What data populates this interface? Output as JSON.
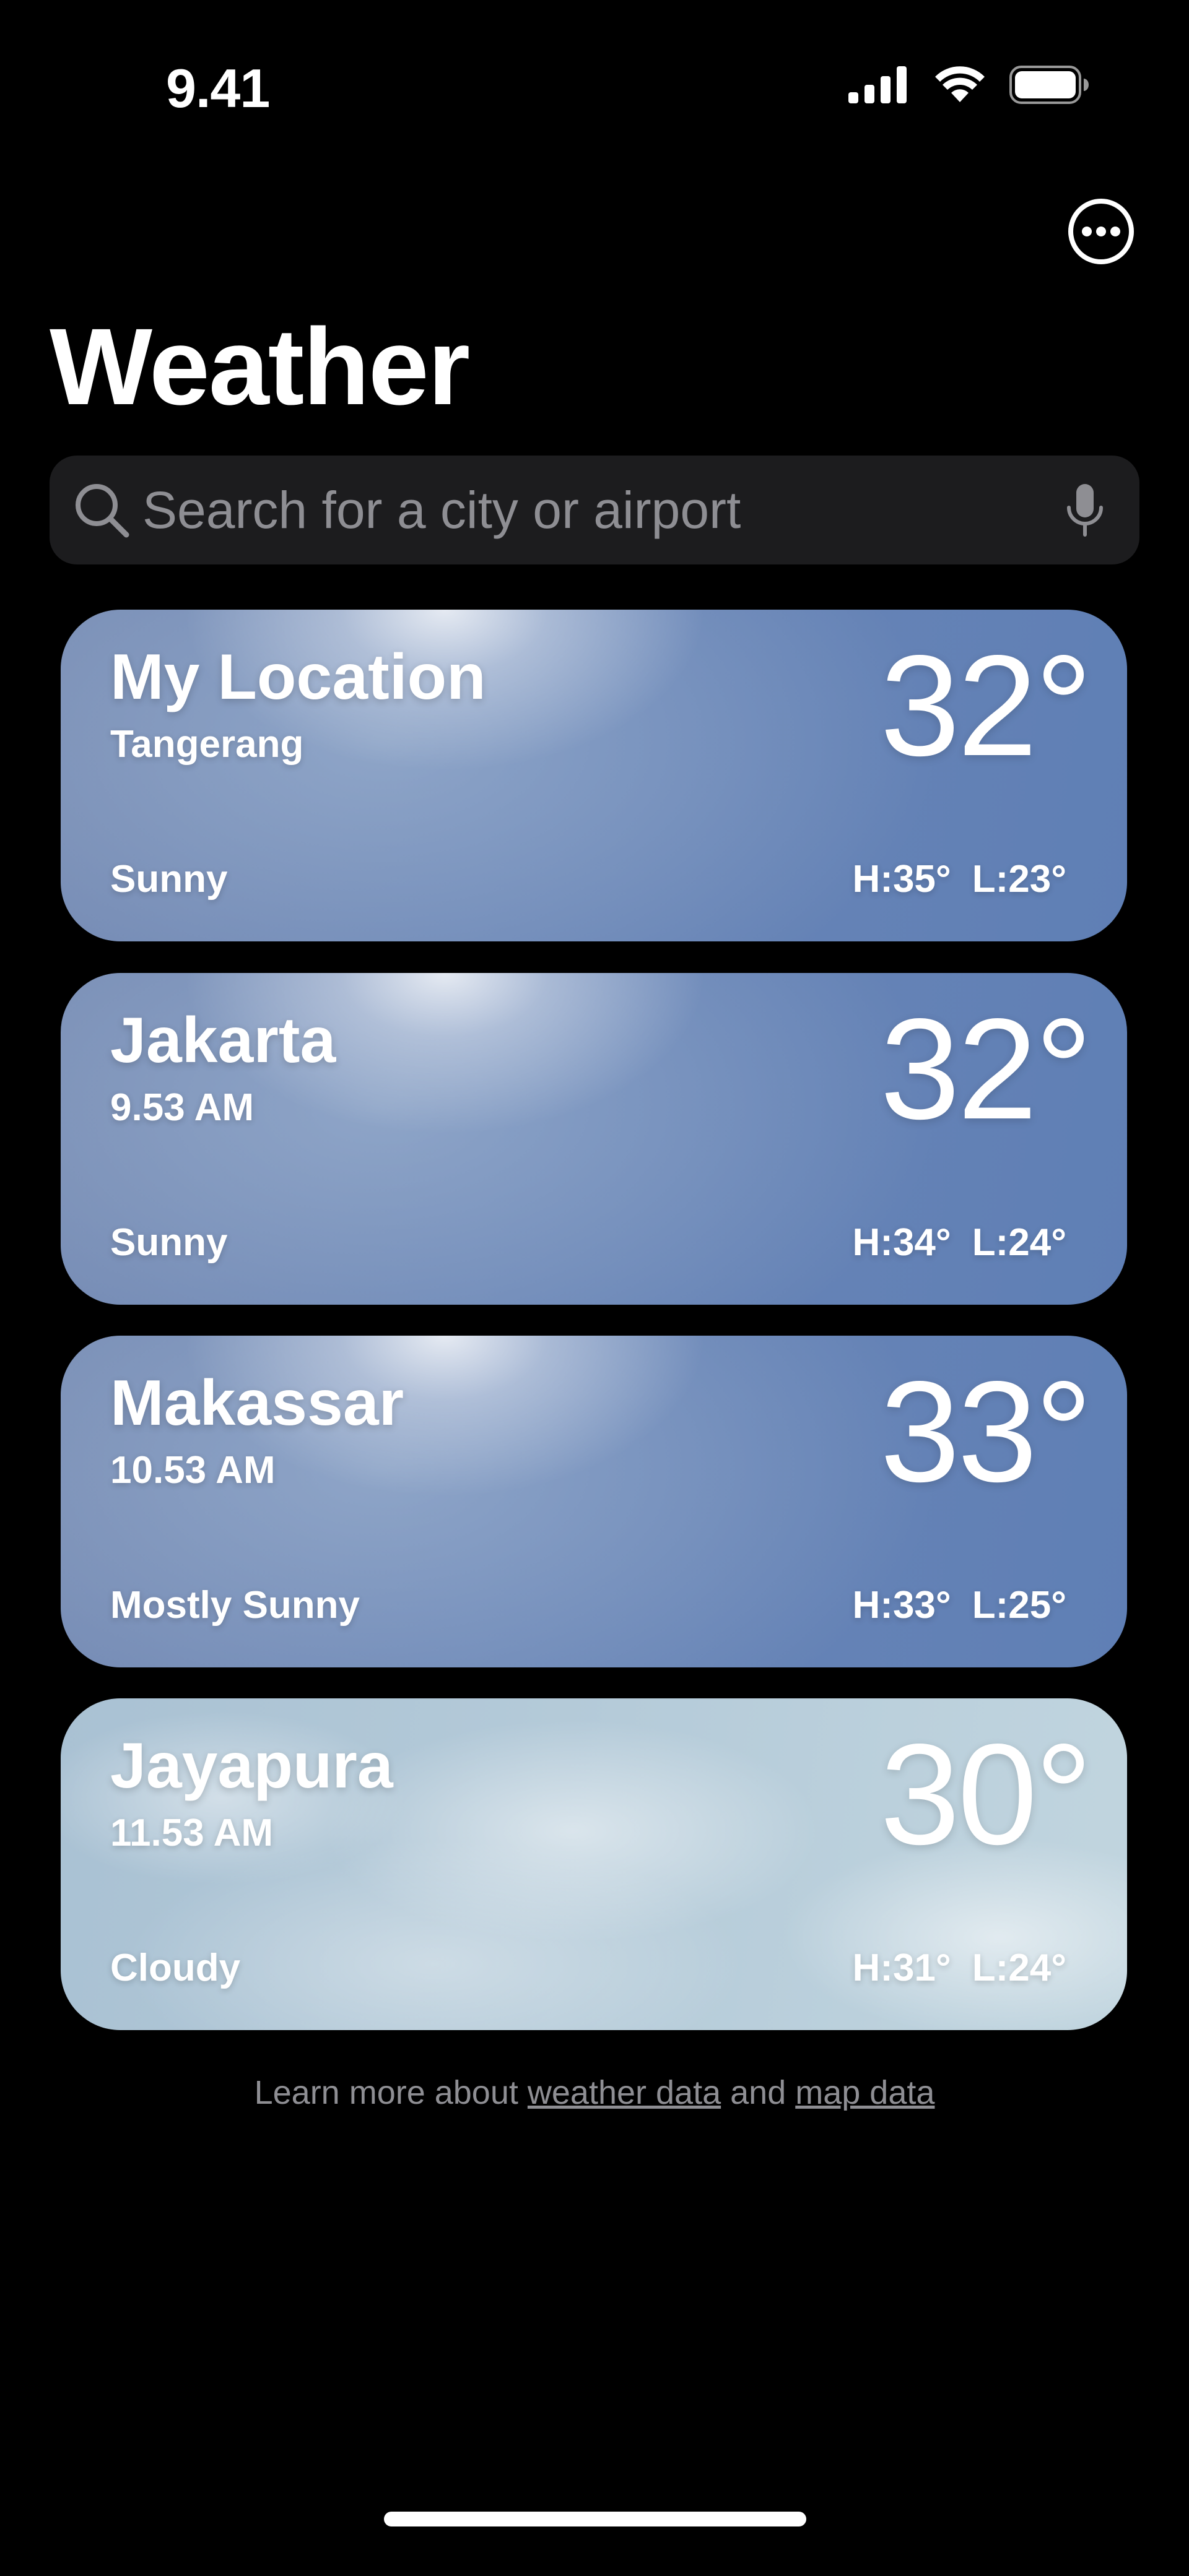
{
  "status_bar": {
    "time": "9.41",
    "icons": [
      "cellular-signal-icon",
      "wifi-icon",
      "battery-icon"
    ]
  },
  "header": {
    "more_icon": "ellipsis-circle-icon",
    "title": "Weather"
  },
  "search": {
    "placeholder": "Search for a city or airport",
    "icon": "search-icon",
    "mic_icon": "mic-icon"
  },
  "locations": [
    {
      "city": "My Location",
      "subtitle": "Tangerang",
      "temp": "32°",
      "condition": "Sunny",
      "high": "H:35°",
      "low": "L:23°",
      "theme": "sunny"
    },
    {
      "city": "Jakarta",
      "subtitle": "9.53 AM",
      "temp": "32°",
      "condition": "Sunny",
      "high": "H:34°",
      "low": "L:24°",
      "theme": "sunny"
    },
    {
      "city": "Makassar",
      "subtitle": "10.53 AM",
      "temp": "33°",
      "condition": "Mostly Sunny",
      "high": "H:33°",
      "low": "L:25°",
      "theme": "sunny"
    },
    {
      "city": "Jayapura",
      "subtitle": "11.53 AM",
      "temp": "30°",
      "condition": "Cloudy",
      "high": "H:31°",
      "low": "L:24°",
      "theme": "cloudy"
    }
  ],
  "footer": {
    "prefix": "Learn more about",
    "weather_link": "weather data",
    "conjunction": "and",
    "map_link": "map data"
  },
  "colors": {
    "background": "#000000",
    "search_background": "#1c1c1e",
    "secondary_text": "#8e8e93"
  }
}
